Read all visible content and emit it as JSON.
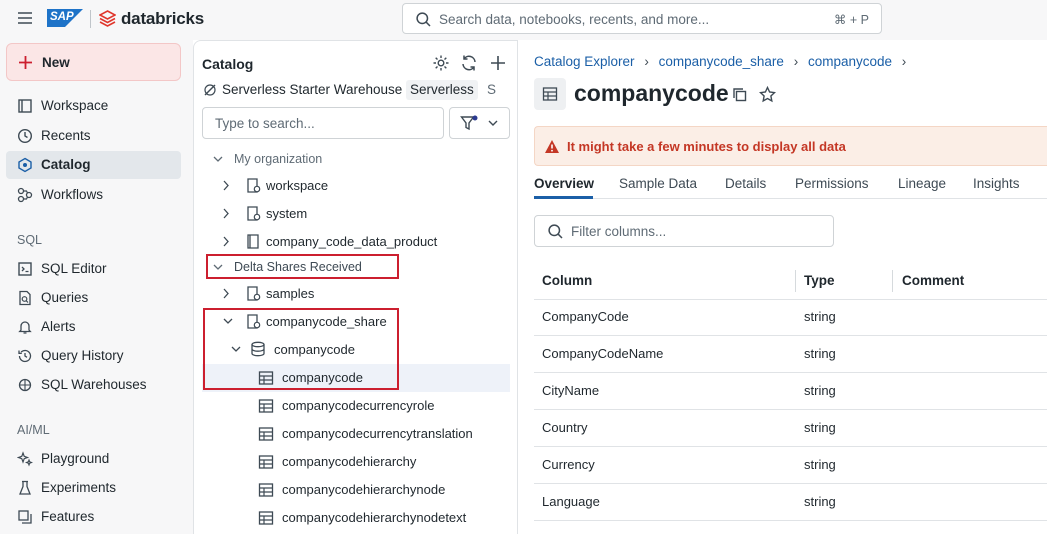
{
  "header": {
    "sap_logo": "SAP",
    "brand": "databricks",
    "search_placeholder": "Search data, notebooks, recents, and more...",
    "search_shortcut": "⌘ + P"
  },
  "nav": {
    "new_label": "New",
    "items": [
      {
        "label": "Workspace",
        "icon": "workspace-icon"
      },
      {
        "label": "Recents",
        "icon": "clock-icon"
      },
      {
        "label": "Catalog",
        "icon": "catalog-icon",
        "active": true
      },
      {
        "label": "Workflows",
        "icon": "workflows-icon"
      }
    ],
    "sql_section": "SQL",
    "sql_items": [
      {
        "label": "SQL Editor",
        "icon": "sql-editor-icon"
      },
      {
        "label": "Queries",
        "icon": "queries-icon"
      },
      {
        "label": "Alerts",
        "icon": "bell-icon"
      },
      {
        "label": "Query History",
        "icon": "history-icon"
      },
      {
        "label": "SQL Warehouses",
        "icon": "warehouse-icon"
      }
    ],
    "aiml_section": "AI/ML",
    "aiml_items": [
      {
        "label": "Playground",
        "icon": "sparkle-icon"
      },
      {
        "label": "Experiments",
        "icon": "flask-icon"
      },
      {
        "label": "Features",
        "icon": "features-icon"
      }
    ]
  },
  "catalog_panel": {
    "title": "Catalog",
    "warehouse_name": "Serverless Starter Warehouse",
    "warehouse_tag": "Serverless",
    "warehouse_size": "S",
    "search_placeholder": "Type to search...",
    "tree": {
      "my_org": "My organization",
      "workspace": "workspace",
      "system": "system",
      "company_code_data_product": "company_code_data_product",
      "delta_shares": "Delta Shares Received",
      "samples": "samples",
      "companycode_share": "companycode_share",
      "companycode_schema": "companycode",
      "tables": [
        "companycode",
        "companycodecurrencyrole",
        "companycodecurrencytranslation",
        "companycodehierarchy",
        "companycodehierarchynode",
        "companycodehierarchynodetext"
      ]
    }
  },
  "main": {
    "breadcrumb": [
      "Catalog Explorer",
      "companycode_share",
      "companycode"
    ],
    "title": "companycode",
    "banner": "It might take a few minutes to display all data",
    "tabs": [
      "Overview",
      "Sample Data",
      "Details",
      "Permissions",
      "Lineage",
      "Insights"
    ],
    "filter_placeholder": "Filter columns...",
    "table_headers": [
      "Column",
      "Type",
      "Comment"
    ],
    "rows": [
      {
        "column": "CompanyCode",
        "type": "string"
      },
      {
        "column": "CompanyCodeName",
        "type": "string"
      },
      {
        "column": "CityName",
        "type": "string"
      },
      {
        "column": "Country",
        "type": "string"
      },
      {
        "column": "Currency",
        "type": "string"
      },
      {
        "column": "Language",
        "type": "string"
      }
    ]
  },
  "colors": {
    "accent": "#1b5fa7",
    "highlight_box": "#cc1f2f",
    "banner_text": "#c43725"
  }
}
